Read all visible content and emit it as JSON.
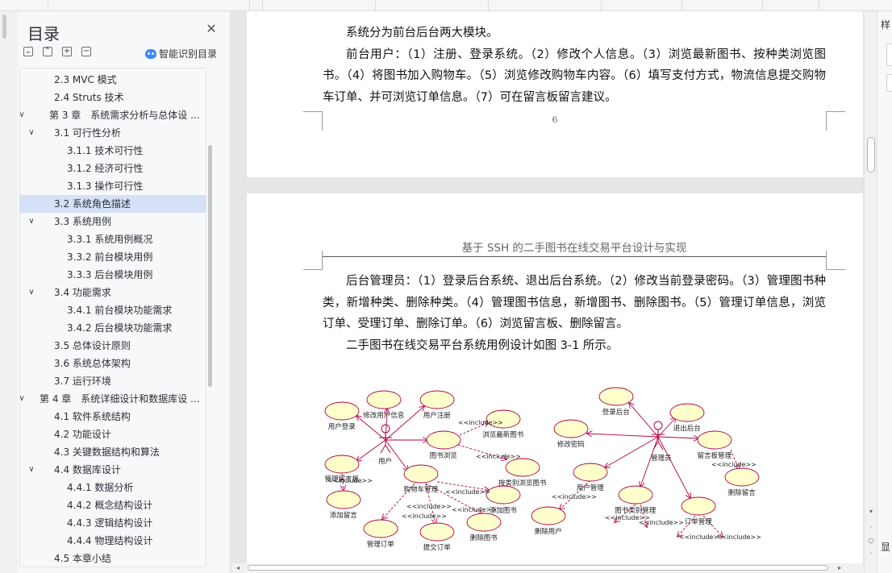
{
  "toc": {
    "title": "目录",
    "smart_label": "智能识别目录",
    "items": [
      {
        "label": "2.3 MVC 模式",
        "level": 2,
        "chevron": ""
      },
      {
        "label": "2.4 Struts 技术",
        "level": 2,
        "chevron": ""
      },
      {
        "label": "第 3 章　系统需求分析与总体设 ...",
        "level": 1,
        "chevron": "∨"
      },
      {
        "label": "3.1  可行性分析",
        "level": 2,
        "chevron": "∨"
      },
      {
        "label": "3.1.1  技术可行性",
        "level": 3,
        "chevron": ""
      },
      {
        "label": "3.1.2  经济可行性",
        "level": 3,
        "chevron": ""
      },
      {
        "label": "3.1.3  操作可行性",
        "level": 3,
        "chevron": ""
      },
      {
        "label": "3.2  系统角色描述",
        "level": 2,
        "chevron": "",
        "active": true
      },
      {
        "label": "3.3  系统用例",
        "level": 2,
        "chevron": "∨"
      },
      {
        "label": "3.3.1  系统用例概况",
        "level": 3,
        "chevron": ""
      },
      {
        "label": "3.3.2  前台模块用例",
        "level": 3,
        "chevron": ""
      },
      {
        "label": "3.3.3  后台模块用例",
        "level": 3,
        "chevron": ""
      },
      {
        "label": "3.4  功能需求",
        "level": 2,
        "chevron": "∨"
      },
      {
        "label": "3.4.1  前台模块功能需求",
        "level": 3,
        "chevron": ""
      },
      {
        "label": "3.4.2  后台模块功能需求",
        "level": 3,
        "chevron": ""
      },
      {
        "label": "3.5  总体设计原则",
        "level": 2,
        "chevron": ""
      },
      {
        "label": "3.6  系统总体架构",
        "level": 2,
        "chevron": ""
      },
      {
        "label": "3.7  运行环境",
        "level": 2,
        "chevron": ""
      },
      {
        "label": "第 4 章　系统详细设计和数据库设 ...",
        "level": 1,
        "chevron": "∨"
      },
      {
        "label": "4.1  软件系统结构",
        "level": 2,
        "chevron": ""
      },
      {
        "label": "4.2  功能设计",
        "level": 2,
        "chevron": ""
      },
      {
        "label": "4.3  关键数据结构和算法",
        "level": 2,
        "chevron": ""
      },
      {
        "label": "4.4  数据库设计",
        "level": 2,
        "chevron": "∨"
      },
      {
        "label": "4.4.1  数据分析",
        "level": 3,
        "chevron": ""
      },
      {
        "label": "4.4.2  概念结构设计",
        "level": 3,
        "chevron": ""
      },
      {
        "label": "4.4.3  逻辑结构设计",
        "level": 3,
        "chevron": ""
      },
      {
        "label": "4.4.4  物理结构设计",
        "level": 3,
        "chevron": ""
      },
      {
        "label": "4.5  本章小结",
        "level": 2,
        "chevron": ""
      }
    ]
  },
  "page1": {
    "para_intro": "系统分为前台后台两大模块。",
    "para_front": "前台用户：（1）注册、登录系统。（2）修改个人信息。（3）浏览最新图书、按种类浏览图书。（4）将图书加入购物车。（5）浏览修改购物车内容。（6）填写支付方式，物流信息提交购物车订单、并可浏览订单信息。（7）可在留言板留言建议。",
    "page_number": "6"
  },
  "page2": {
    "header": "基于 SSH 的二手图书在线交易平台设计与实现",
    "para_admin": "后台管理员：（1）登录后台系统、退出后台系统。（2）修改当前登录密码。（3）管理图书种类，新增种类、删除种类。（4）管理图书信息，新增图书、删除图书。（5）管理订单信息，浏览订单、受理订单、删除订单。（6）浏览留言板、删除留言。",
    "para_figure": "二手图书在线交易平台系统用例设计如图 3-1 所示。"
  },
  "diagram": {
    "actors": [
      "用户",
      "管理员"
    ],
    "use_cases": [
      "用户登录",
      "修改用户信息",
      "用户注册",
      "浏览最新图书",
      "图书浏览",
      "管理留言板",
      "按类别浏览图书",
      "购物车管理",
      "添加图书",
      "添加留言",
      "删除图书",
      "管理订单",
      "提交订单",
      "登录后台",
      "退出后台",
      "修改密码",
      "留言板管理",
      "用户管理",
      "图书类别管理",
      "订单管理",
      "删除留言",
      "删除用户"
    ],
    "include_label": "<<include>>"
  },
  "right_panel": {
    "label_top": "样",
    "label_bottom": "显"
  }
}
